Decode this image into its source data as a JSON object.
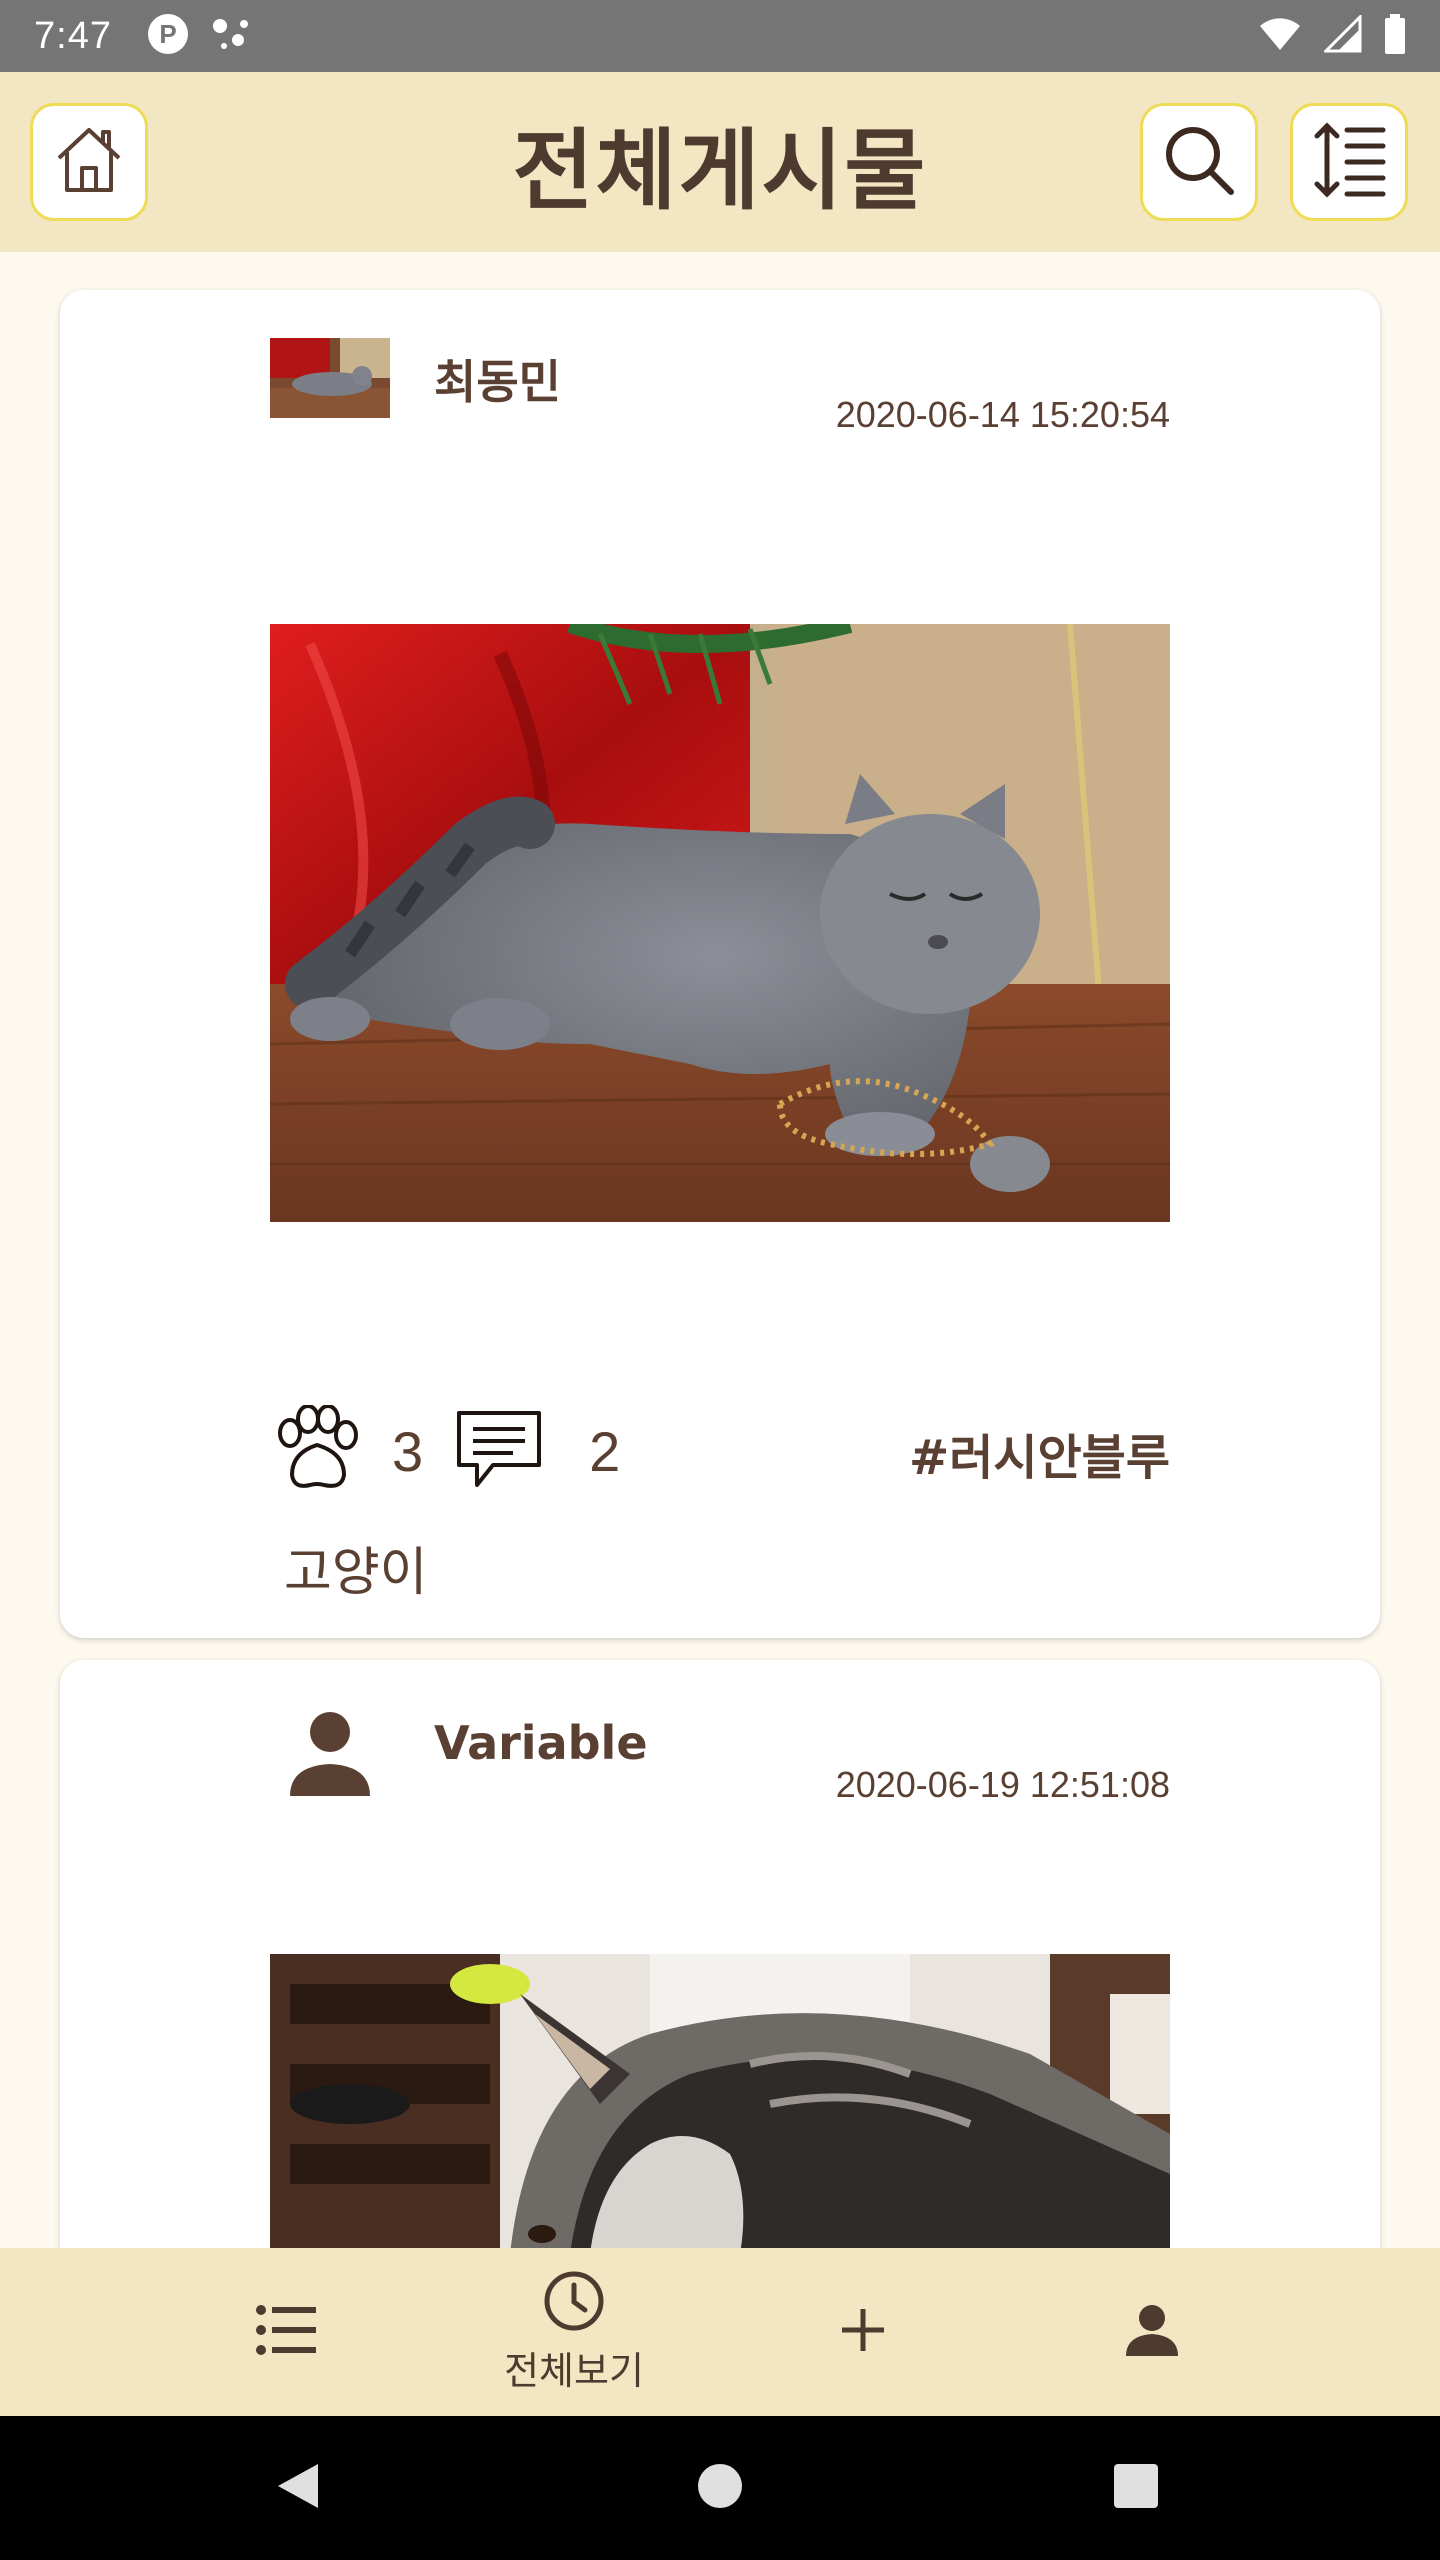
{
  "status_bar": {
    "time": "7:47",
    "left_icons": [
      "p-badge-icon",
      "assistant-dots-icon"
    ],
    "right_icons": [
      "wifi-icon",
      "cell-signal-icon",
      "battery-icon"
    ]
  },
  "app_bar": {
    "title": "전체게시물",
    "left_button_icon": "home-icon",
    "right_buttons": [
      "search-icon",
      "sort-icon"
    ],
    "accent_border": "#EEDC57",
    "background": "#F3E6C3"
  },
  "posts": [
    {
      "author": "최동민",
      "avatar": "cat-thumbnail",
      "date": "2020-06-14 15:20:54",
      "image": "gray-cat-photo",
      "likes": "3",
      "comments": "2",
      "hashtag": "#러시안블루",
      "text": "고양이"
    },
    {
      "author": "Variable",
      "avatar": "person-icon",
      "date": "2020-06-19 12:51:08",
      "image": "husky-photo"
    }
  ],
  "bottom_nav": {
    "items": [
      {
        "icon": "list-icon",
        "label": ""
      },
      {
        "icon": "clock-icon",
        "label": "전체보기"
      },
      {
        "icon": "plus-icon",
        "label": ""
      },
      {
        "icon": "person-icon",
        "label": ""
      }
    ]
  },
  "system_nav": [
    "back-icon",
    "home-circle-icon",
    "recents-icon"
  ]
}
